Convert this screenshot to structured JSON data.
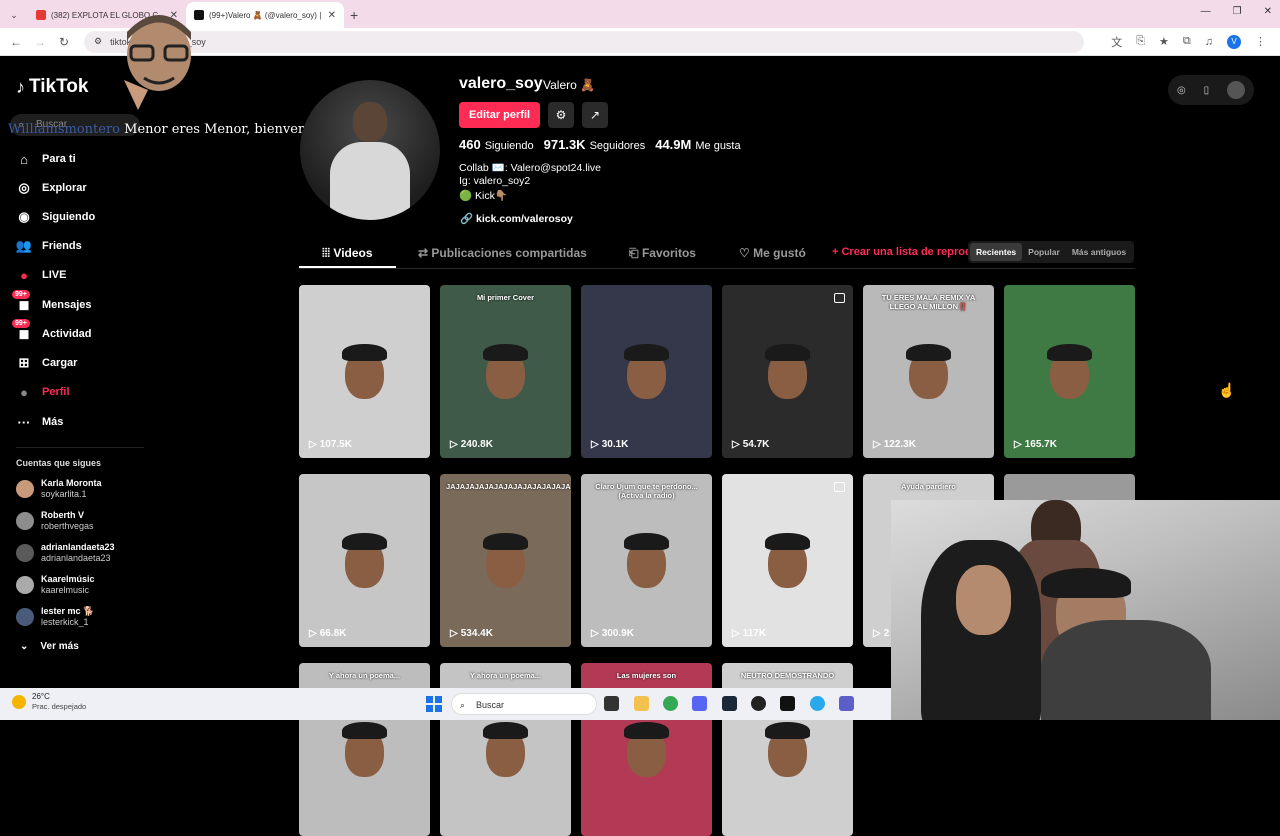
{
  "browser": {
    "tabs": [
      {
        "title": "(382) EXPLOTA EL GLOBO C",
        "color": "#e53935",
        "active": false
      },
      {
        "title": "(99+)Valero 🧸 (@valero_soy) |",
        "color": "#111111",
        "active": true
      }
    ],
    "new_tab": "+",
    "url": "tiktok.com/@valero_soy",
    "profile_initial": "V"
  },
  "sidebar": {
    "logo": "TikTok",
    "search_placeholder": "Buscar",
    "items": [
      {
        "label": "Para ti",
        "icon": "home-icon",
        "glyph": "⌂",
        "badge": ""
      },
      {
        "label": "Explorar",
        "icon": "compass-icon",
        "glyph": "◎",
        "badge": ""
      },
      {
        "label": "Siguiendo",
        "icon": "following-icon",
        "glyph": "◉",
        "badge": ""
      },
      {
        "label": "Friends",
        "icon": "friends-icon",
        "glyph": "👥",
        "badge": ""
      },
      {
        "label": "LIVE",
        "icon": "live-icon",
        "glyph": "●",
        "badge": ""
      },
      {
        "label": "Mensajes",
        "icon": "messages-icon",
        "glyph": "◼",
        "badge": "99+"
      },
      {
        "label": "Actividad",
        "icon": "activity-icon",
        "glyph": "◼",
        "badge": "99+"
      },
      {
        "label": "Cargar",
        "icon": "upload-icon",
        "glyph": "⊞",
        "badge": ""
      },
      {
        "label": "Perfil",
        "icon": "profile-icon",
        "glyph": "●",
        "badge": ""
      },
      {
        "label": "Más",
        "icon": "more-icon",
        "glyph": "···",
        "badge": ""
      }
    ],
    "following_title": "Cuentas que sigues",
    "followed_accounts": [
      {
        "name": "Karla Moronta",
        "user": "soykarlita.1"
      },
      {
        "name": "Roberth V",
        "user": "roberthvegas"
      },
      {
        "name": "adrianlandaeta23",
        "user": "adrianlandaeta23"
      },
      {
        "name": "Kaarelmúsic",
        "user": "kaarelmusic"
      },
      {
        "name": "lester mc 🐕",
        "user": "lesterkick_1"
      }
    ],
    "see_more": "Ver más"
  },
  "overlay": {
    "user": "Williamsmontero",
    "message": "Menor eres Menor, bienvenido!"
  },
  "profile": {
    "username": "valero_soy",
    "nickname": "Valero 🧸",
    "edit_button": "Editar perfil",
    "stats": [
      {
        "value": "460",
        "label": "Siguiendo"
      },
      {
        "value": "971.3K",
        "label": "Seguidores"
      },
      {
        "value": "44.9M",
        "label": "Me gusta"
      }
    ],
    "bio_lines": [
      "Collab ✉️: Valero@spot24.live",
      "Ig: valero_soy2",
      "🟢 Kick👇🏽"
    ],
    "link": "kick.com/valerosoy"
  },
  "tabs": {
    "items": [
      "Videos",
      "Publicaciones compartidas",
      "Favoritos",
      "Me gustó"
    ],
    "create_playlist": "+ Crear una lista de reproducción",
    "sort_options": [
      "Recientes",
      "Popular",
      "Más antiguos"
    ],
    "active_sort": "Recientes"
  },
  "videos": [
    {
      "views": "107.5K",
      "caption": "",
      "bg": "#cfcfcf",
      "multi": false
    },
    {
      "views": "240.8K",
      "caption": "Mi primer Cover",
      "bg": "#3f5a48",
      "multi": false
    },
    {
      "views": "30.1K",
      "caption": "",
      "bg": "#35374a",
      "multi": false
    },
    {
      "views": "54.7K",
      "caption": "",
      "bg": "#2b2b2b",
      "multi": true
    },
    {
      "views": "122.3K",
      "caption": "TU ERES MALA REMIX YA LLEGO AL MILLON‼️",
      "bg": "#b9b9b9",
      "multi": false
    },
    {
      "views": "165.7K",
      "caption": "",
      "bg": "#3f7a45",
      "multi": false
    },
    {
      "views": "66.8K",
      "caption": "",
      "bg": "#c6c6c6",
      "multi": false
    },
    {
      "views": "534.4K",
      "caption": "JAJAJAJAJAJAJAJAJAJAJAJAJAJAJAJAJAJAJAJAKAKKA",
      "bg": "#7a6a5a",
      "multi": false
    },
    {
      "views": "300.9K",
      "caption": "Claro Ujum que te perdono... (Activa la radio)",
      "bg": "#bdbdbd",
      "multi": false
    },
    {
      "views": "117K",
      "caption": "",
      "bg": "#e2e2e2",
      "multi": true
    },
    {
      "views": "2",
      "caption": "Ayuda pardiero",
      "bg": "#cfcfcf",
      "multi": false
    },
    {
      "views": "",
      "caption": "",
      "bg": "#9a9a9a",
      "multi": false
    },
    {
      "views": "",
      "caption": "Y ahora un poema...",
      "bg": "#bdbdbd",
      "multi": false
    },
    {
      "views": "",
      "caption": "Y ahora un poema...",
      "bg": "#c4c4c4",
      "multi": false
    },
    {
      "views": "",
      "caption": "Las mujeres son",
      "bg": "#b33a55",
      "multi": false
    },
    {
      "views": "",
      "caption": "NEUTRO DEMOSTRANDO",
      "bg": "#cfcfcf",
      "multi": false
    }
  ],
  "taskbar": {
    "weather_temp": "26°C",
    "weather_desc": "Prac. despejado",
    "search_placeholder": "Buscar"
  },
  "colors": {
    "accent": "#fe2c55",
    "background": "#000000"
  }
}
